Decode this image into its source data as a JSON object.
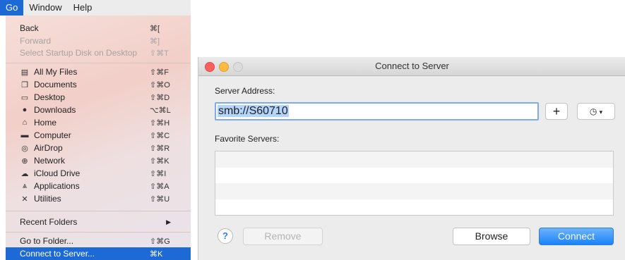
{
  "menubar": {
    "items": [
      "Go",
      "Window",
      "Help"
    ]
  },
  "go_menu": {
    "group1": [
      {
        "label": "Back",
        "shortcut": "⌘["
      },
      {
        "label": "Forward",
        "shortcut": "⌘]"
      },
      {
        "label": "Select Startup Disk on Desktop",
        "shortcut": "⇧⌘T"
      }
    ],
    "group2": [
      {
        "label": "All My Files",
        "shortcut": "⇧⌘F",
        "icon": "all-files-icon"
      },
      {
        "label": "Documents",
        "shortcut": "⇧⌘O",
        "icon": "documents-icon"
      },
      {
        "label": "Desktop",
        "shortcut": "⇧⌘D",
        "icon": "desktop-icon"
      },
      {
        "label": "Downloads",
        "shortcut": "⌥⌘L",
        "icon": "downloads-icon"
      },
      {
        "label": "Home",
        "shortcut": "⇧⌘H",
        "icon": "home-icon"
      },
      {
        "label": "Computer",
        "shortcut": "⇧⌘C",
        "icon": "computer-icon"
      },
      {
        "label": "AirDrop",
        "shortcut": "⇧⌘R",
        "icon": "airdrop-icon"
      },
      {
        "label": "Network",
        "shortcut": "⇧⌘K",
        "icon": "network-icon"
      },
      {
        "label": "iCloud Drive",
        "shortcut": "⇧⌘I",
        "icon": "icloud-icon"
      },
      {
        "label": "Applications",
        "shortcut": "⇧⌘A",
        "icon": "applications-icon"
      },
      {
        "label": "Utilities",
        "shortcut": "⇧⌘U",
        "icon": "utilities-icon"
      }
    ],
    "recent_folders": {
      "label": "Recent Folders"
    },
    "go_to_folder": {
      "label": "Go to Folder...",
      "shortcut": "⇧⌘G"
    },
    "connect_to_server": {
      "label": "Connect to Server...",
      "shortcut": "⌘K"
    }
  },
  "dialog": {
    "title": "Connect to Server",
    "server_address_label": "Server Address:",
    "server_address_value": "smb://S60710",
    "favorite_servers_label": "Favorite Servers:",
    "add_label": "+",
    "help_label": "?",
    "remove_label": "Remove",
    "browse_label": "Browse",
    "connect_label": "Connect"
  },
  "colors": {
    "accent": "#1d6ad6",
    "connect_button": "#1a82fb"
  }
}
